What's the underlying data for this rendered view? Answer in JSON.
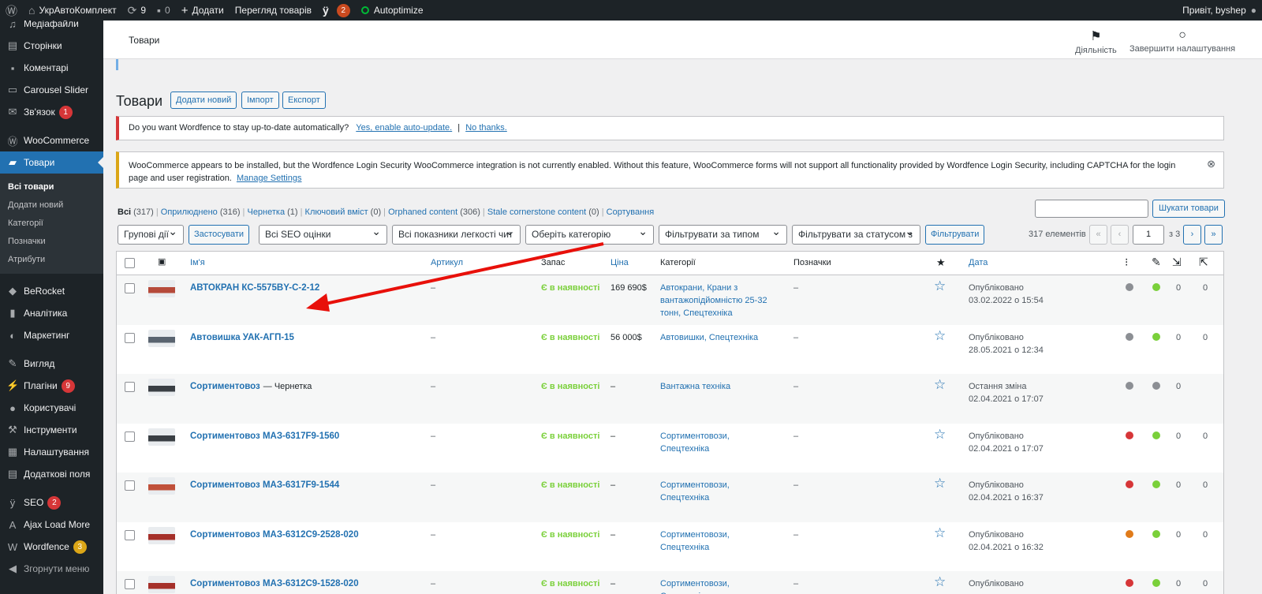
{
  "adminbar": {
    "site_name": "УкрАвтоКомплект",
    "updates": "9",
    "comments": "0",
    "add_new": "Додати",
    "view_products": "Перегляд товарів",
    "yoast_count": "2",
    "autoptimize": "Autoptimize",
    "greeting": "Привіт, byshep"
  },
  "sidebar": {
    "items": [
      {
        "label": "Медіафайли",
        "icon": "media-icon"
      },
      {
        "label": "Сторінки",
        "icon": "page-icon"
      },
      {
        "label": "Коментарі",
        "icon": "comment-icon"
      },
      {
        "label": "Carousel Slider",
        "icon": "slider-icon"
      },
      {
        "label": "Зв'язок",
        "icon": "mail-icon",
        "badge": "1"
      },
      {
        "label": "WooCommerce",
        "icon": "woo-icon"
      },
      {
        "label": "Товари",
        "icon": "product-icon",
        "current": true
      },
      {
        "label": "BeRocket",
        "icon": "berocket-icon"
      },
      {
        "label": "Аналітика",
        "icon": "chart-icon"
      },
      {
        "label": "Маркетинг",
        "icon": "megaphone-icon"
      },
      {
        "label": "Вигляд",
        "icon": "brush-icon"
      },
      {
        "label": "Плагіни",
        "icon": "plugin-icon",
        "badge": "9"
      },
      {
        "label": "Користувачі",
        "icon": "user-icon"
      },
      {
        "label": "Інструменти",
        "icon": "wrench-icon"
      },
      {
        "label": "Налаштування",
        "icon": "settings-icon"
      },
      {
        "label": "Додаткові поля",
        "icon": "fields-icon"
      },
      {
        "label": "SEO",
        "icon": "yoast-icon",
        "badge": "2"
      },
      {
        "label": "Ajax Load More",
        "icon": "ajax-icon"
      },
      {
        "label": "Wordfence",
        "icon": "wordfence-icon",
        "badge": "3"
      },
      {
        "label": "Згорнути меню",
        "icon": "collapse-icon"
      }
    ],
    "submenu": [
      "Всі товари",
      "Додати новий",
      "Категорії",
      "Позначки",
      "Атрибути"
    ]
  },
  "topbar": {
    "title": "Товари",
    "activity": "Діяльність",
    "finish_setup": "Завершити налаштування"
  },
  "page": {
    "title": "Товари",
    "add_new": "Додати новий",
    "import": "Імпорт",
    "export": "Експорт"
  },
  "notice1": {
    "text": "Do you want Wordfence to stay up-to-date automatically?",
    "yes": "Yes, enable auto-update.",
    "sep": "|",
    "no": "No thanks."
  },
  "notice2": {
    "text": "WooCommerce appears to be installed, but the Wordfence Login Security WooCommerce integration is not currently enabled. Without this feature, WooCommerce forms will not support all functionality provided by Wordfence Login Security, including CAPTCHA for the login page and user registration.",
    "link": "Manage Settings"
  },
  "views": [
    {
      "label": "Всі",
      "count": "(317)",
      "current": true
    },
    {
      "label": "Оприлюднено",
      "count": "(316)"
    },
    {
      "label": "Чернетка",
      "count": "(1)"
    },
    {
      "label": "Ключовий вміст",
      "count": "(0)"
    },
    {
      "label": "Orphaned content",
      "count": "(306)"
    },
    {
      "label": "Stale cornerstone content",
      "count": "(0)"
    },
    {
      "label": "Сортування",
      "count": ""
    }
  ],
  "search": {
    "button": "Шукати товари",
    "value": ""
  },
  "filters": {
    "bulk": "Групові дії",
    "apply": "Застосувати",
    "seo": "Всі SEO оцінки",
    "readability": "Всі показники легкості чит",
    "category": "Оберіть категорію",
    "type": "Фільтрувати за типом",
    "stock": "Фільтрувати за статусом з",
    "filter": "Фільтрувати"
  },
  "pagination": {
    "count": "317 елементів",
    "first": "«",
    "prev": "‹",
    "current": "1",
    "of": "з 3",
    "next": "›",
    "last": "»"
  },
  "table": {
    "headers": {
      "name": "Ім'я",
      "sku": "Артикул",
      "stock": "Запас",
      "price": "Ціна",
      "categories": "Категорії",
      "tags": "Позначки",
      "date": "Дата"
    },
    "rows": [
      {
        "name": "АВТОКРАН КС-5575BY-C-2-12",
        "suffix": "",
        "sku": "–",
        "stock": "Є в наявності",
        "price": "169 690$",
        "categories": "Автокрани, Крани з вантажопідйомністю 25-32 тонн, Спецтехніка",
        "tags": "–",
        "status": "Опубліковано",
        "date": "03.02.2022 о 15:54",
        "seo": "#8c8f94",
        "read": "#7ad03a",
        "links": "0",
        "linked": "0",
        "thumb": "#b54a3a"
      },
      {
        "name": "Автовишка УАК-АГП-15",
        "suffix": "",
        "sku": "–",
        "stock": "Є в наявності",
        "price": "56 000$",
        "categories": "Автовишки, Спецтехніка",
        "tags": "–",
        "status": "Опубліковано",
        "date": "28.05.2021 о 12:34",
        "seo": "#8c8f94",
        "read": "#7ad03a",
        "links": "0",
        "linked": "0",
        "thumb": "#5a6470"
      },
      {
        "name": "Сортиментовоз",
        "suffix": "— Чернетка",
        "sku": "–",
        "stock": "Є в наявності",
        "price": "–",
        "categories": "Вантажна техніка",
        "tags": "–",
        "status": "Остання зміна",
        "date": "02.04.2021 о 17:07",
        "seo": "#8c8f94",
        "read": "#8c8f94",
        "links": "0",
        "linked": "",
        "thumb": "#3a3f44"
      },
      {
        "name": "Сортиментовоз МАЗ-6317F9-1560",
        "suffix": "",
        "sku": "–",
        "stock": "Є в наявності",
        "price": "–",
        "categories": "Сортиментовози, Спецтехніка",
        "tags": "–",
        "status": "Опубліковано",
        "date": "02.04.2021 о 17:07",
        "seo": "#d63638",
        "read": "#7ad03a",
        "links": "0",
        "linked": "0",
        "thumb": "#3a3f44"
      },
      {
        "name": "Сортиментовоз МАЗ-6317F9-1544",
        "suffix": "",
        "sku": "–",
        "stock": "Є в наявності",
        "price": "–",
        "categories": "Сортиментовози, Спецтехніка",
        "tags": "–",
        "status": "Опубліковано",
        "date": "02.04.2021 о 16:37",
        "seo": "#d63638",
        "read": "#7ad03a",
        "links": "0",
        "linked": "0",
        "thumb": "#c0503a"
      },
      {
        "name": "Сортиментовоз МАЗ-6312С9-2528-020",
        "suffix": "",
        "sku": "–",
        "stock": "Є в наявності",
        "price": "–",
        "categories": "Сортиментовози, Спецтехніка",
        "tags": "–",
        "status": "Опубліковано",
        "date": "02.04.2021 о 16:32",
        "seo": "#e07b1a",
        "read": "#7ad03a",
        "links": "0",
        "linked": "0",
        "thumb": "#a5302a"
      },
      {
        "name": "Сортиментовоз МАЗ-6312С9-1528-020",
        "suffix": "",
        "sku": "–",
        "stock": "Є в наявності",
        "price": "–",
        "categories": "Сортиментовози, Спецтехніка",
        "tags": "–",
        "status": "Опубліковано",
        "date": "",
        "seo": "#d63638",
        "read": "#7ad03a",
        "links": "0",
        "linked": "0",
        "thumb": "#a5302a"
      }
    ]
  },
  "colors": {
    "accent": "#2271b1",
    "sidebar_bg": "#1d2327",
    "in_stock": "#7ad03a",
    "annotation_arrow": "#e8100a"
  }
}
